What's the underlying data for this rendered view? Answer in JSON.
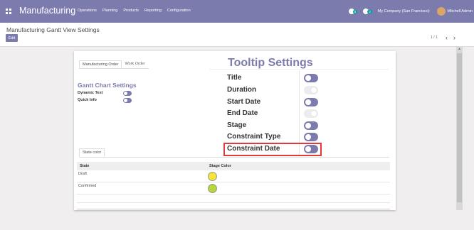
{
  "topbar": {
    "app_name": "Manufacturing",
    "menu": [
      "Operations",
      "Planning",
      "Products",
      "Reporting",
      "Configuration"
    ],
    "activity_badge": "5",
    "messages_badge": "3",
    "company": "My Company (San Francisco)",
    "user": "Mitchell Admin",
    "color": "#7c7bad"
  },
  "control": {
    "breadcrumb": "Manufacturing Gantt View Settings",
    "edit_label": "Edit",
    "pager": "1 / 1",
    "prev": "‹",
    "next": "›"
  },
  "tabs": {
    "manufacturing_order": "Manufacturing Order",
    "work_order": "Work Order"
  },
  "gantt": {
    "title": "Gantt Chart Settings",
    "dynamic_text_label": "Dynamic Text",
    "dynamic_text_on": true,
    "quick_info_label": "Quick Info",
    "quick_info_on": true
  },
  "tooltip": {
    "title": "Tooltip Settings",
    "items": [
      {
        "label": "Title",
        "on": true
      },
      {
        "label": "Duration",
        "on": false
      },
      {
        "label": "Start Date",
        "on": true
      },
      {
        "label": "End Date",
        "on": false
      },
      {
        "label": "Stage",
        "on": true
      },
      {
        "label": "Constraint Type",
        "on": true
      },
      {
        "label": "Constraint Date",
        "on": true
      }
    ]
  },
  "state_color": {
    "tab_label": "State color",
    "columns": [
      "State",
      "Stage Color"
    ],
    "rows": [
      {
        "state": "Draft",
        "color": "#f5e53a"
      },
      {
        "state": "Confirmed",
        "color": "#b5d63a"
      }
    ]
  }
}
